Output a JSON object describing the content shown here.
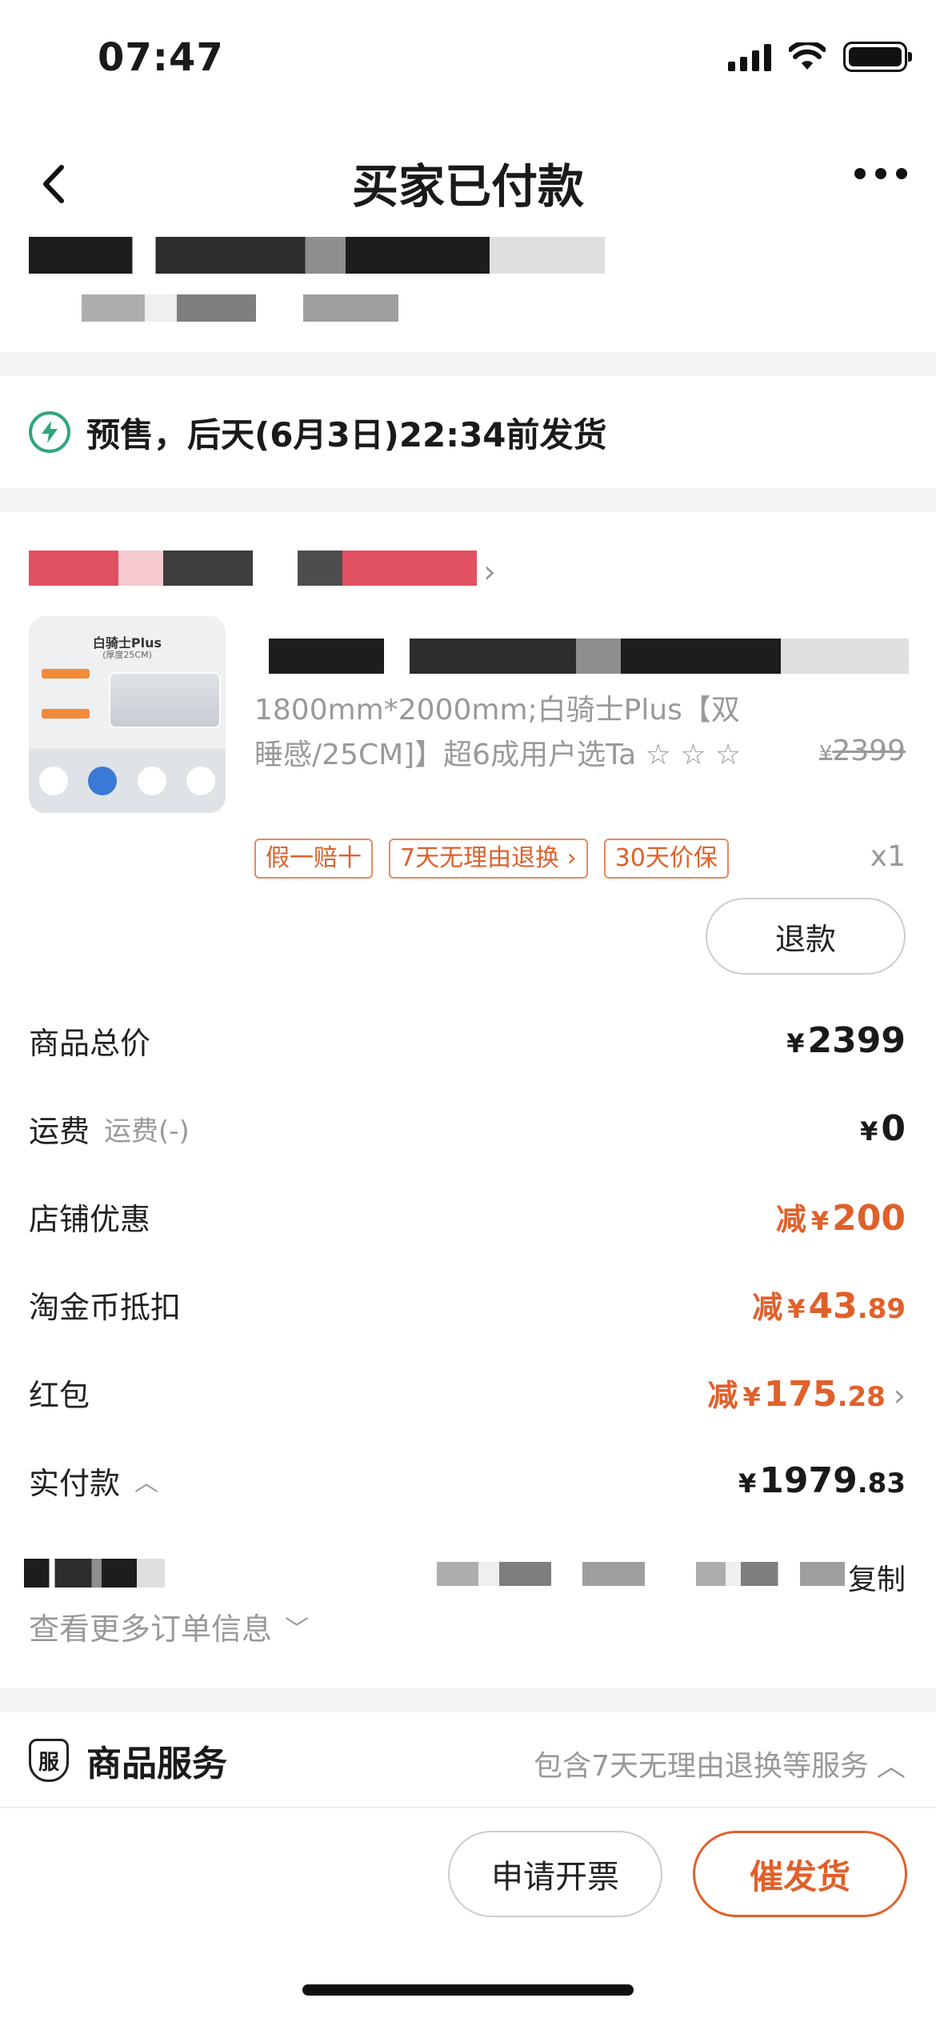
{
  "status_bar": {
    "time": "07:47"
  },
  "header": {
    "title": "买家已付款"
  },
  "shipping": {
    "text": "预售，后天(6月3日)22:34前发货"
  },
  "product": {
    "thumb_title": "白骑士Plus",
    "thumb_sub": "(厚度25CM)",
    "spec": "1800mm*2000mm;白骑士Plus【双睡感/25CM]】超6成用户选Ta ☆ ☆ ☆",
    "orig_price_currency": "¥",
    "orig_price": "2399",
    "tags": [
      "假一赔十",
      "7天无理由退换",
      "30天价保"
    ],
    "quantity": "x1",
    "refund_label": "退款"
  },
  "prices": {
    "total_label": "商品总价",
    "total_value": "2399",
    "shipping_label": "运费",
    "shipping_sub": "运费(-)",
    "shipping_value": "0",
    "store_discount_label": "店铺优惠",
    "store_discount_value": "200",
    "coin_label": "淘金币抵扣",
    "coin_value_int": "43",
    "coin_value_dec": ".89",
    "redpacket_label": "红包",
    "redpacket_value_int": "175",
    "redpacket_value_dec": ".28",
    "paid_label": "实付款",
    "paid_value_int": "1979",
    "paid_value_dec": ".83",
    "currency": "¥",
    "minus_prefix": "减"
  },
  "order_info": {
    "copy_label": "复制",
    "more_label": "查看更多订单信息"
  },
  "service": {
    "icon_char": "服",
    "title": "商品服务",
    "desc": "包含7天无理由退换等服务"
  },
  "actions": {
    "invoice_label": "申请开票",
    "urge_label": "催发货"
  },
  "colors": {
    "accent": "#e0602a",
    "bolt": "#2ea67a"
  }
}
